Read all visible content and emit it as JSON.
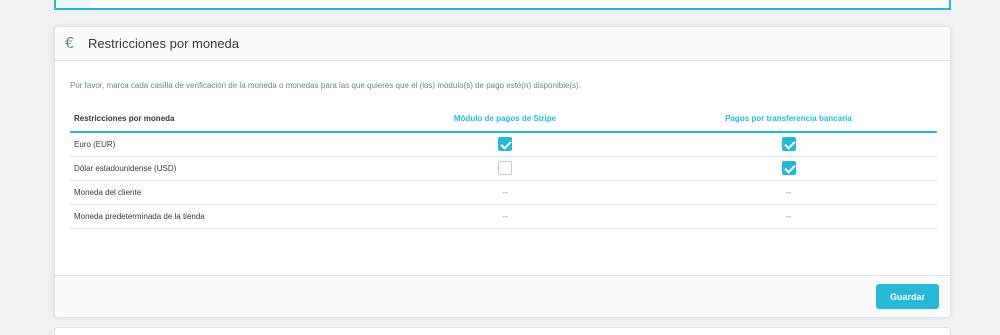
{
  "panel": {
    "title": "Restricciones por moneda",
    "icon": "euro-icon",
    "help_text": "Por favor, marca cada casilla de verificación de la moneda o monedas para las que quieres que el (los) módulo(s) de pago esté(n) disponible(s)."
  },
  "table": {
    "headers": [
      "Restricciones por moneda",
      "Módulo de pagos de Stripe",
      "Pagos por transferencia bancaria"
    ],
    "rows": [
      {
        "label": "Euro (EUR)",
        "stripe": true,
        "transfer": true
      },
      {
        "label": "Dólar estadounidense (USD)",
        "stripe": false,
        "transfer": true
      },
      {
        "label": "Moneda del cliente",
        "stripe": "--",
        "transfer": "--"
      },
      {
        "label": "Moneda predeterminada de la tienda",
        "stripe": "--",
        "transfer": "--"
      }
    ]
  },
  "footer": {
    "save_label": "Guardar"
  },
  "colors": {
    "accent": "#25b9d7",
    "border": "#dbe6e9",
    "background": "#eff1f2"
  }
}
